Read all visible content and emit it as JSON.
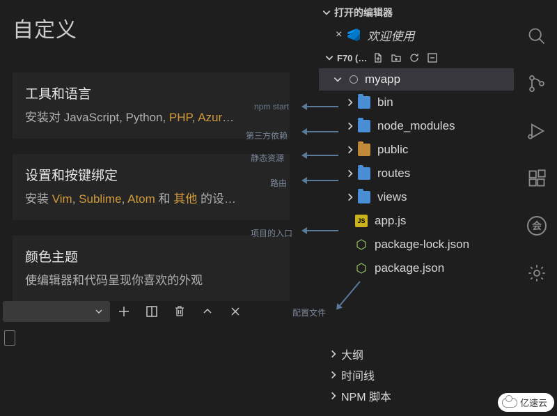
{
  "welcome": {
    "title": "自定义",
    "cards": [
      {
        "title": "工具和语言",
        "pre": "安装对 JavaScript, Python, ",
        "hl1": "PHP",
        "mid": ", ",
        "hl2": "Azur",
        "tail": "…"
      },
      {
        "title": "设置和按键绑定",
        "pre": "安装 ",
        "hl1": "Vim",
        "mid": ", ",
        "hl2": "Sublime",
        "mid2": ", ",
        "hl3": "Atom",
        "post": " 和 ",
        "hl4": "其他",
        "tail": " 的设…"
      },
      {
        "title": "颜色主题",
        "pre": "使编辑器和代码呈现你喜欢的外观"
      }
    ]
  },
  "annotations": {
    "npmstart": "npm start",
    "deps": "第三方依赖",
    "static": "静态资源",
    "route": "路由",
    "entry": "项目的入口",
    "config": "配置文件"
  },
  "explorer": {
    "openEditors": "打开的编辑器",
    "welcomeTab": "欢迎使用",
    "folderHeader": "F70 (…",
    "root": "myapp",
    "tree": [
      {
        "label": "bin",
        "type": "folder"
      },
      {
        "label": "node_modules",
        "type": "folder"
      },
      {
        "label": "public",
        "type": "folder-pub"
      },
      {
        "label": "routes",
        "type": "folder"
      },
      {
        "label": "views",
        "type": "folder"
      },
      {
        "label": "app.js",
        "type": "js"
      },
      {
        "label": "package-lock.json",
        "type": "json"
      },
      {
        "label": "package.json",
        "type": "json"
      }
    ],
    "outline": "大纲",
    "timeline": "时间线",
    "npm": "NPM 脚本"
  },
  "brand": {
    "text": "亿速云"
  },
  "account": {
    "badge": "会"
  }
}
